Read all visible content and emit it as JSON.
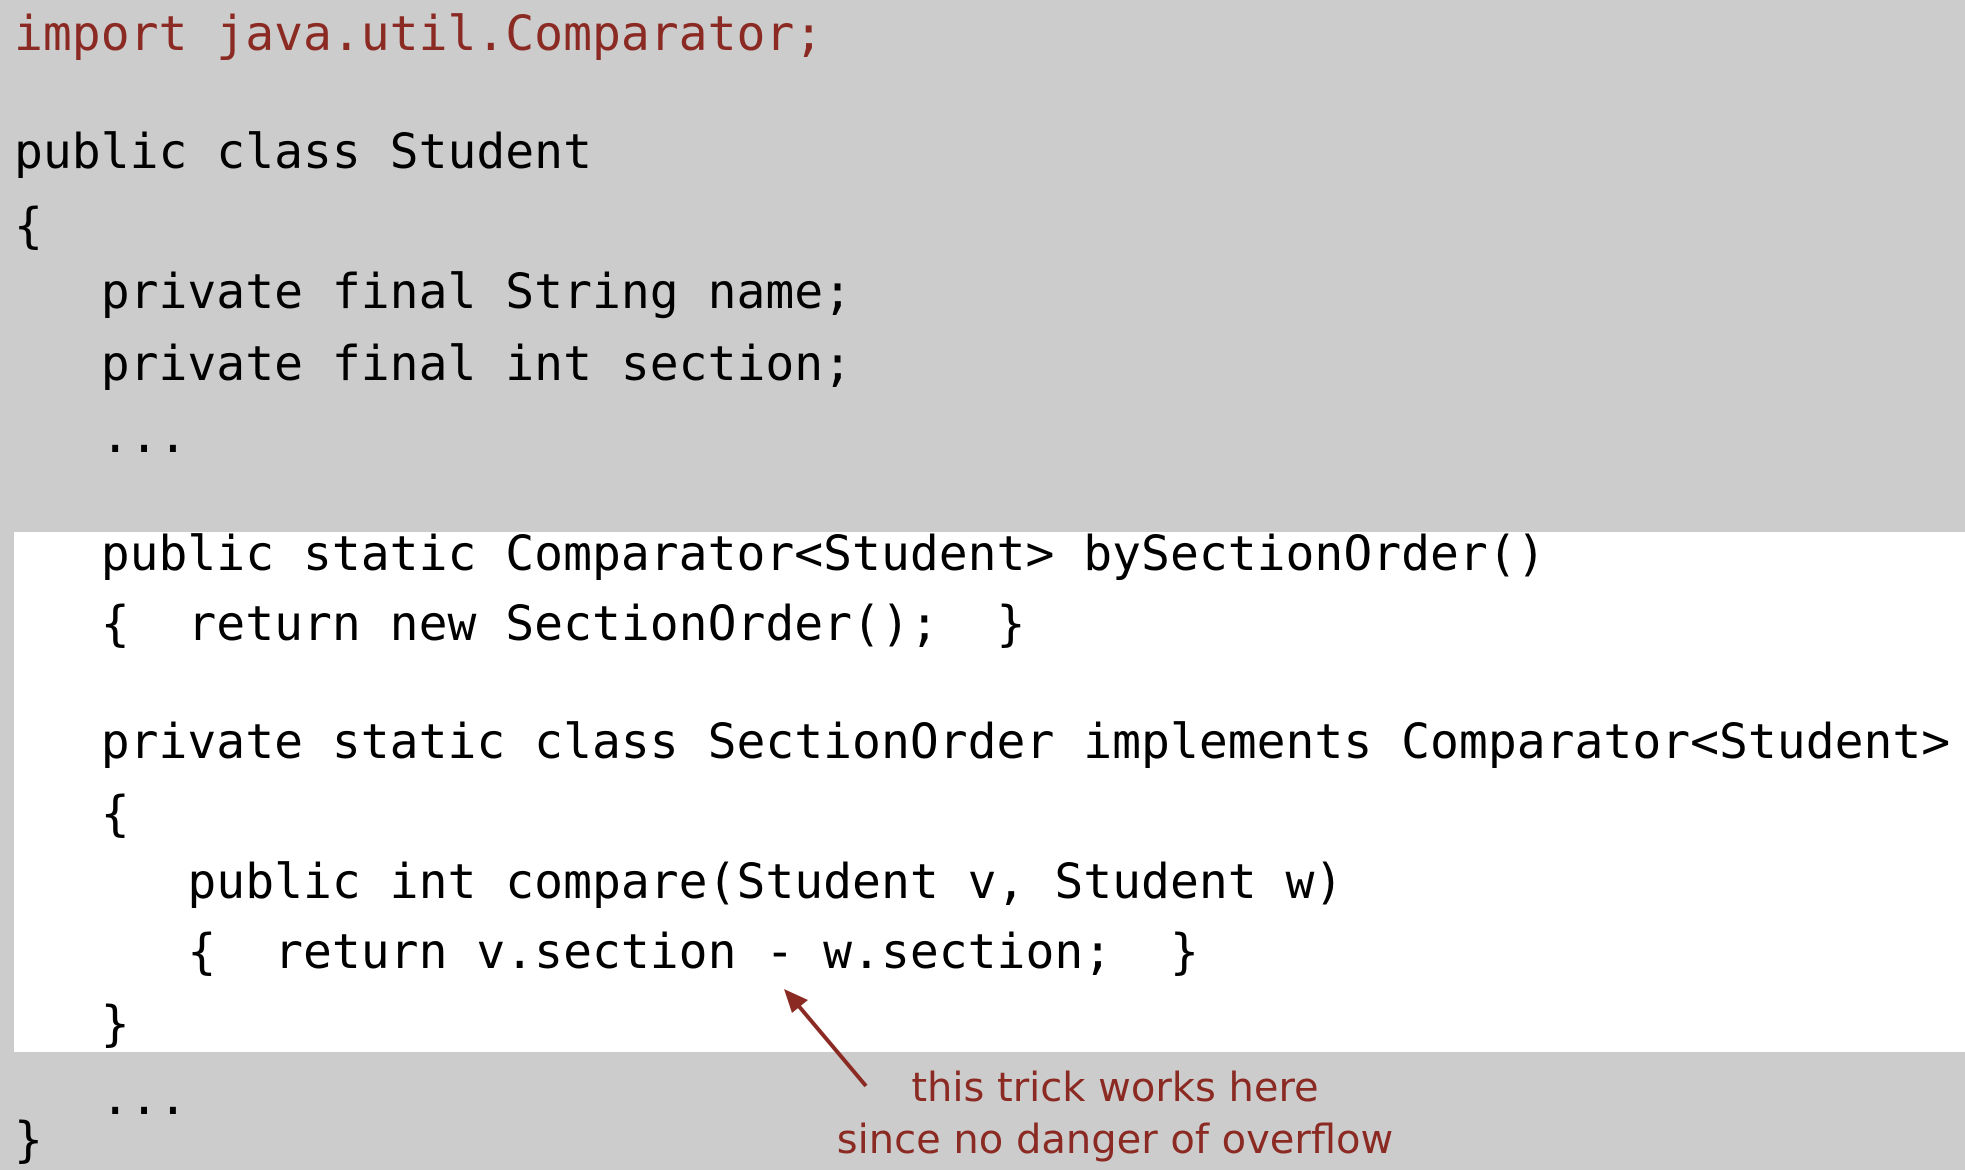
{
  "code": {
    "import_line": "import java.util.Comparator;",
    "class_decl": "public class Student",
    "open_class": "{",
    "field_name": "   private final String name;",
    "field_section": "   private final int section;",
    "ellipsis_1": "   ...",
    "method_decl": "   public static Comparator<Student> bySectionOrder()",
    "method_body": "   {  return new SectionOrder();  }",
    "inner_class_decl": "   private static class SectionOrder implements Comparator<Student>",
    "inner_open": "   {",
    "compare_decl": "      public int compare(Student v, Student w)",
    "compare_body": "      {  return v.section - w.section;  }",
    "inner_close": "   }",
    "ellipsis_2": "   ...",
    "close_class": "}"
  },
  "annotation": {
    "line1": "this trick works here",
    "line2": "since no danger of overflow"
  },
  "colors": {
    "background": "#cccccc",
    "highlight": "#ffffff",
    "accent": "#8b2a23",
    "text": "#000000"
  }
}
